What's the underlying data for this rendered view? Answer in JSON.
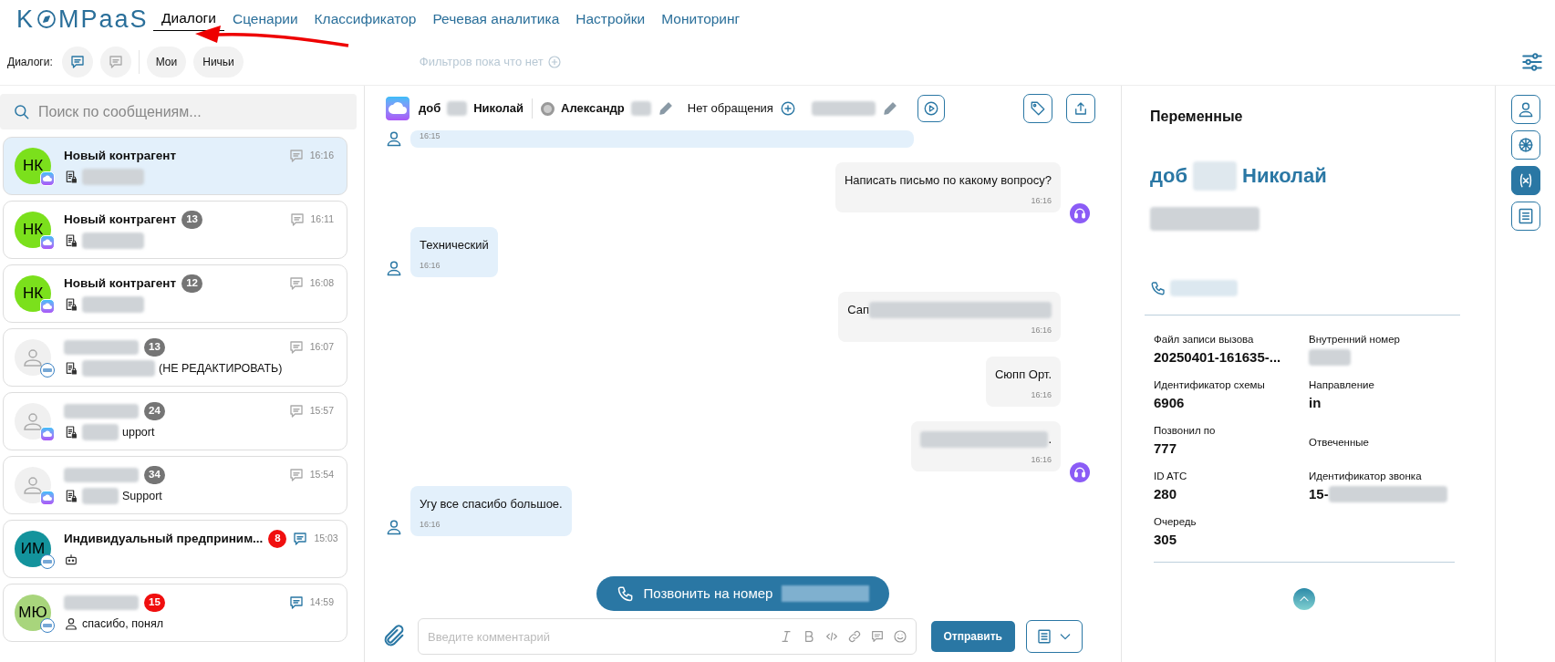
{
  "logo": {
    "before": "K",
    "after": "MPaaS"
  },
  "nav_tabs": [
    {
      "label": "Диалоги",
      "selected": true
    },
    {
      "label": "Сценарии",
      "selected": false
    },
    {
      "label": "Классификатор",
      "selected": false
    },
    {
      "label": "Речевая аналитика",
      "selected": false
    },
    {
      "label": "Настройки",
      "selected": false
    },
    {
      "label": "Мониторинг",
      "selected": false
    }
  ],
  "annotation_arrow": true,
  "filter_bar": {
    "label": "Диалоги:",
    "toggles": [
      {
        "selected": true
      },
      {
        "selected": false
      }
    ],
    "chips": [
      {
        "label": "Мои"
      },
      {
        "label": "Ничьи"
      }
    ],
    "filters_text": "Фильтров пока что нет"
  },
  "search": {
    "placeholder": "Поиск по сообщениям..."
  },
  "dialogs": [
    {
      "selected": true,
      "avatar": {
        "kind": "initials",
        "initials": "НК",
        "color": "#7be01c"
      },
      "badge": {
        "kind": "cloud"
      },
      "title": "Новый контрагент",
      "preview_icon": {
        "kind": "doc"
      },
      "preview_blurred": true,
      "time": "16:16",
      "unread": false
    },
    {
      "selected": false,
      "avatar": {
        "kind": "initials",
        "initials": "НК",
        "color": "#7be01c"
      },
      "badge": {
        "kind": "cloud"
      },
      "title": "Новый контрагент",
      "count": {
        "text": "13",
        "color": "#757575"
      },
      "preview_icon": {
        "kind": "doc"
      },
      "preview_blurred": true,
      "time": "16:11",
      "unread": false
    },
    {
      "selected": false,
      "avatar": {
        "kind": "initials",
        "initials": "НК",
        "color": "#7be01c"
      },
      "badge": {
        "kind": "cloud"
      },
      "title": "Новый контрагент",
      "count": {
        "text": "12",
        "color": "#757575"
      },
      "preview_icon": {
        "kind": "doc"
      },
      "preview_blurred": true,
      "time": "16:08",
      "unread": false
    },
    {
      "selected": false,
      "avatar": {
        "kind": "placeholder"
      },
      "badge": {
        "kind": "mcn"
      },
      "title_blurred": true,
      "count": {
        "text": "13",
        "color": "#757575"
      },
      "preview_icon": {
        "kind": "doc"
      },
      "preview_blurred": true,
      "preview": "(НЕ РЕДАКТИРОВАТЬ)",
      "time": "16:07",
      "unread": false
    },
    {
      "selected": false,
      "avatar": {
        "kind": "placeholder"
      },
      "badge": {
        "kind": "cloud"
      },
      "title_blurred": true,
      "count": {
        "text": "24",
        "color": "#757575"
      },
      "preview_icon": {
        "kind": "doc"
      },
      "preview_blurred": true,
      "preview": "upport",
      "time": "15:57",
      "unread": false
    },
    {
      "selected": false,
      "avatar": {
        "kind": "placeholder"
      },
      "badge": {
        "kind": "cloud"
      },
      "title_blurred": true,
      "count": {
        "text": "34",
        "color": "#757575"
      },
      "preview_icon": {
        "kind": "doc"
      },
      "preview_blurred": true,
      "preview": "Support",
      "time": "15:54",
      "unread": false
    },
    {
      "selected": false,
      "avatar": {
        "kind": "initials",
        "initials": "ИМ",
        "color": "#13939c"
      },
      "badge": {
        "kind": "mcn"
      },
      "title": "Индивидуальный предприним...",
      "count": {
        "text": "8",
        "color": "#f00f0f"
      },
      "preview_icon": {
        "kind": "robot"
      },
      "time": "15:03",
      "unread": true
    },
    {
      "selected": false,
      "avatar": {
        "kind": "initials",
        "initials": "МЮ",
        "color": "#a8d57c"
      },
      "badge": {
        "kind": "mcn"
      },
      "title_blurred": true,
      "count": {
        "text": "15",
        "color": "#f00f0f"
      },
      "preview_icon": {
        "kind": "person"
      },
      "preview": "спасибо, понял",
      "time": "14:59",
      "unread": true
    }
  ],
  "chat_header": {
    "contact_before": "доб",
    "contact_blurred": true,
    "contact_after": "Николай",
    "operator": "Александр",
    "operator_blurred": true,
    "request": "Нет обращения",
    "request_blurred": true
  },
  "messages": [
    {
      "kind": "incoming",
      "time": "16:15",
      "avatar": true
    },
    {
      "kind": "outgoing",
      "text": "Написать письмо по какому вопросу?",
      "time": "16:16",
      "avatar": true
    },
    {
      "kind": "incoming",
      "text": "Технический",
      "time": "16:16",
      "avatar": true
    },
    {
      "kind": "outgoing",
      "text": "Сап",
      "blurred": true,
      "time": "16:16",
      "avatar": false
    },
    {
      "kind": "outgoing",
      "text": "Сюпп Орт.",
      "time": "16:16",
      "avatar": false
    },
    {
      "kind": "outgoing",
      "blurred": true,
      "text_after": ".",
      "time": "16:16",
      "avatar": true
    },
    {
      "kind": "incoming",
      "text": "Угу все спасибо большое.",
      "time": "16:16",
      "avatar": true
    }
  ],
  "call_button": {
    "label": "Позвонить на номер",
    "number_blurred": true
  },
  "composer": {
    "placeholder": "Введите комментарий",
    "send": "Отправить"
  },
  "variables_panel": {
    "title": "Переменные",
    "name_before": "доб",
    "name_blurred": true,
    "name_after": "Николай",
    "subtitle_blurred": true,
    "phone_blurred": true,
    "variables": [
      {
        "label": "Файл записи вызова",
        "value": "20250401-161635-..."
      },
      {
        "label": "Внутренний номер",
        "value_blurred": true
      },
      {
        "label": "Идентификатор схемы",
        "value": "6906"
      },
      {
        "label": "Направление",
        "value": "in"
      },
      {
        "label": "Позвонил по",
        "value": "777"
      },
      {
        "label": "Отвеченные"
      },
      {
        "label": "ID ATC",
        "value": "280"
      },
      {
        "label": "Идентификатор звонка",
        "value": "15-",
        "value_blurred": true
      },
      {
        "label": "Очередь",
        "value": "305"
      }
    ]
  },
  "side_tabs": [
    {
      "kind": "contact",
      "selected": false
    },
    {
      "kind": "ai",
      "selected": false
    },
    {
      "kind": "variables",
      "selected": true
    },
    {
      "kind": "notes",
      "selected": false
    }
  ]
}
